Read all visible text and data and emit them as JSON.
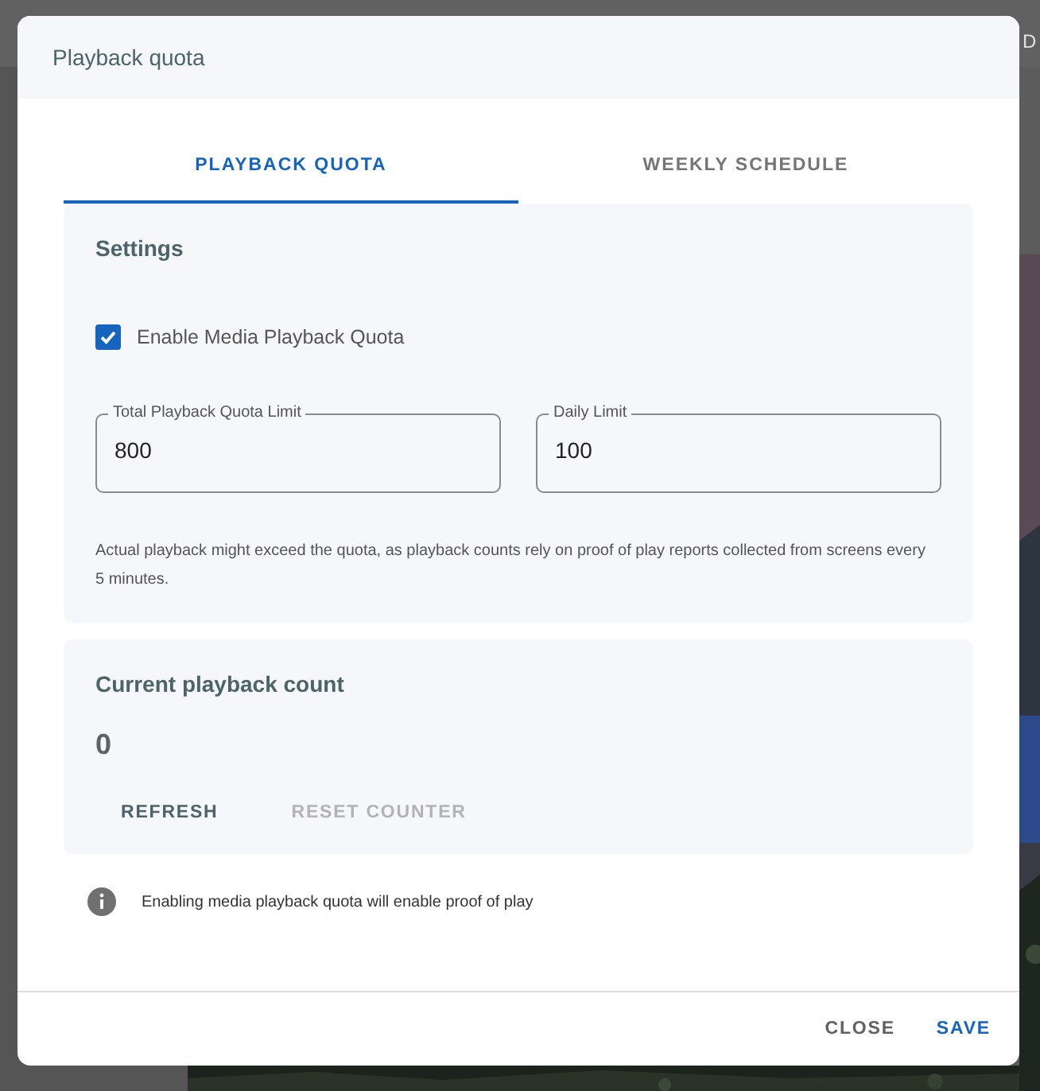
{
  "background": {
    "header_fragment": "D"
  },
  "dialog": {
    "title": "Playback quota",
    "tabs": [
      {
        "label": "PLAYBACK QUOTA",
        "selected": true
      },
      {
        "label": "WEEKLY SCHEDULE",
        "selected": false
      }
    ],
    "settings": {
      "heading": "Settings",
      "enable_checkbox": {
        "label": "Enable Media Playback Quota",
        "checked": true
      },
      "fields": [
        {
          "label": "Total Playback Quota Limit",
          "value": "800"
        },
        {
          "label": "Daily Limit",
          "value": "100"
        }
      ],
      "note": "Actual playback might exceed the quota, as playback counts rely on proof of play reports collected from screens every 5 minutes."
    },
    "count": {
      "heading": "Current playback count",
      "value": "0",
      "buttons": [
        {
          "label": "REFRESH",
          "disabled": false
        },
        {
          "label": "RESET COUNTER",
          "disabled": true
        }
      ]
    },
    "info": "Enabling media playback quota will enable proof of play",
    "footer_buttons": [
      {
        "label": "CLOSE",
        "kind": "secondary"
      },
      {
        "label": "SAVE",
        "kind": "primary"
      }
    ]
  }
}
